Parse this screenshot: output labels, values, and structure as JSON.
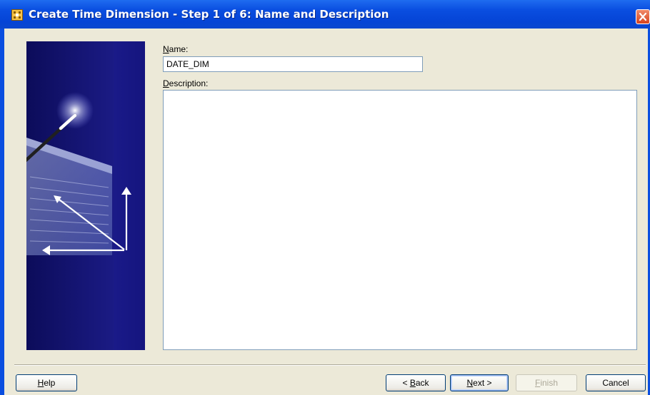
{
  "window": {
    "title": "Create Time Dimension - Step 1 of 6: Name and Description",
    "icon": "wizard-grid-icon",
    "close_icon": "close-icon",
    "titlebar_color": "#0a4ee0"
  },
  "form": {
    "name_label": {
      "mnemonic": "N",
      "rest": "ame:"
    },
    "name_value": "DATE_DIM",
    "description_label": {
      "mnemonic": "D",
      "rest": "escription:"
    },
    "description_value": ""
  },
  "buttons": {
    "help": {
      "mnemonic": "H",
      "rest": "elp"
    },
    "back": {
      "prefix": "< ",
      "mnemonic": "B",
      "rest": "ack"
    },
    "next": {
      "mnemonic": "N",
      "rest": "ext >"
    },
    "finish": {
      "mnemonic": "F",
      "rest": "inish"
    },
    "cancel": "Cancel"
  },
  "banner": {
    "icon": "magic-wand-illustration-icon",
    "bg_color": "#12126e"
  }
}
